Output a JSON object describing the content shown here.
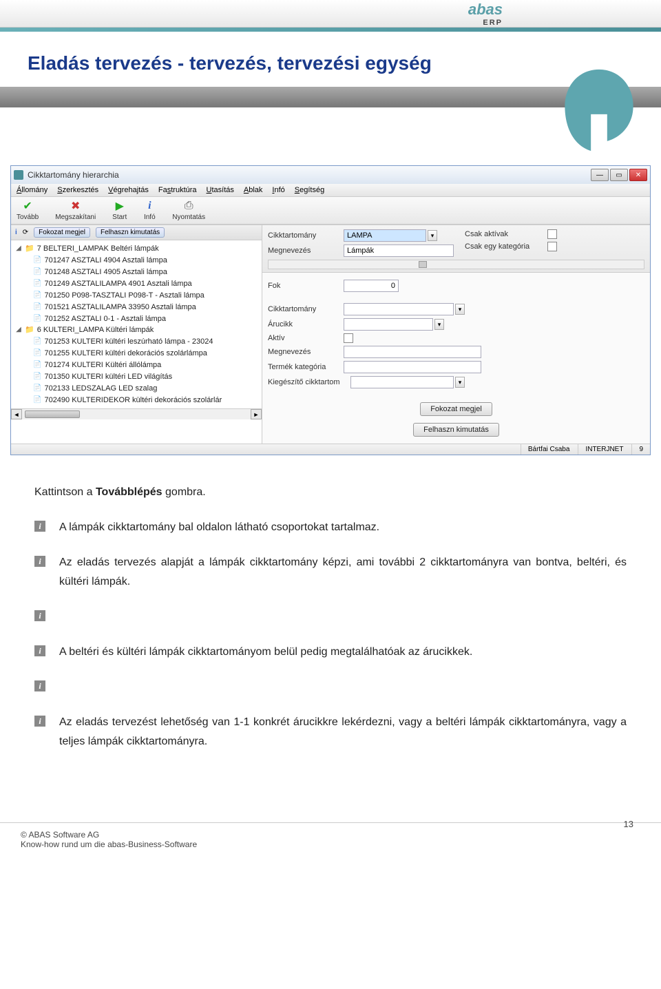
{
  "header": {
    "brand": "abas",
    "brand_sub": "ERP",
    "title": "Eladás tervezés - tervezés, tervezési egység"
  },
  "window": {
    "title": "Cikktartomány hierarchia",
    "menus": [
      "Állomány",
      "Szerkesztés",
      "Végrehajtás",
      "Fastruktúra",
      "Utasítás",
      "Ablak",
      "Infó",
      "Segítség"
    ],
    "toolbar": {
      "continue": "Tovább",
      "interrupt": "Megszakítani",
      "start": "Start",
      "info": "Infó",
      "print": "Nyomtatás"
    },
    "tree_header": {
      "pill1": "Fokozat megjel",
      "pill2": "Felhaszn kimutatás"
    },
    "tree": {
      "groups": [
        {
          "label": "7 BELTERI_LAMPAK Beltéri lámpák",
          "items": [
            "701247 ASZTALI 4904 Asztali lámpa",
            "701248 ASZTALI 4905 Asztali lámpa",
            "701249 ASZTALILAMPA 4901 Asztali lámpa",
            "701250 P098-TASZTALI P098-T - Asztali lámpa",
            "701521 ASZTALILAMPA 33950 Asztali lámpa",
            "701252 ASZTALI 0-1 - Asztali lámpa"
          ]
        },
        {
          "label": "6 KULTERI_LAMPA Kültéri lámpák",
          "items": [
            "701253 KULTERI kültéri leszúrható lámpa - 23024",
            "701255 KULTERI kültéri dekorációs szolárlámpa",
            "701274 KULTERI Kültéri állólámpa",
            "701350 KULTERI kültéri LED világítás",
            "702133 LEDSZALAG LED szalag",
            "702490 KULTERIDEKOR kültéri dekorációs szolárlár"
          ]
        }
      ]
    },
    "form": {
      "cikktartomany_label": "Cikktartomány",
      "cikktartomany_value": "LAMPA",
      "megnevezes_label": "Megnevezés",
      "megnevezes_value": "Lámpák",
      "csak_aktivak_label": "Csak aktívak",
      "csak_egy_kategoria_label": "Csak egy kategória",
      "fok_label": "Fok",
      "fok_value": "0",
      "cikktartomany2_label": "Cikktartomány",
      "arucikk_label": "Árucikk",
      "aktiv_label": "Aktív",
      "megnevezes2_label": "Megnevezés",
      "termek_kategoria_label": "Termék kategória",
      "kiegeszito_label": "Kiegészítő cikktartom",
      "btn_fokozat": "Fokozat megjel",
      "btn_felhaszn": "Felhaszn kimutatás"
    },
    "status": {
      "user": "Bártfai Csaba",
      "net": "INTERJNET",
      "num": "9"
    }
  },
  "doc": {
    "p1a": "Kattintson a ",
    "p1b": "Továbblépés",
    "p1c": " gombra.",
    "p2": "A lámpák cikktartomány bal oldalon látható csoportokat tartalmaz.",
    "p3": "Az eladás tervezés alapját a lámpák cikktartomány képzi, ami további 2 cikktartományra van bontva, beltéri, és kültéri lámpák.",
    "p4": "A beltéri és kültéri lámpák cikktartományom belül pedig megtalálhatóak az árucikkek.",
    "p5": "Az eladás tervezést lehetőség van 1-1 konkrét árucikkre lekérdezni, vagy a beltéri lámpák cikktartományra, vagy a teljes lámpák cikktartományra."
  },
  "footer": {
    "copyright": "© ABAS Software AG",
    "tagline": "Know-how rund um die abas-Business-Software",
    "page": "13"
  }
}
